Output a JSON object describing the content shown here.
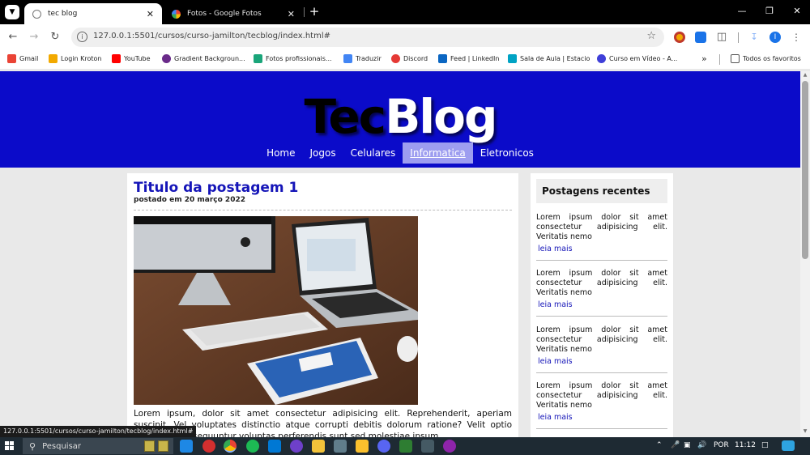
{
  "browser": {
    "tabs": [
      {
        "title": "tec blog",
        "active": true,
        "icon": "globe-icon"
      },
      {
        "title": "Fotos - Google Fotos",
        "active": false,
        "icon": "google-photos-icon"
      }
    ],
    "url": "127.0.0.1:5501/cursos/curso-jamilton/tecblog/index.html#",
    "profile_initial": "I",
    "bookmarks": [
      {
        "label": "Gmail",
        "color": "#ea4335"
      },
      {
        "label": "Login Kroton",
        "color": "#f2a900"
      },
      {
        "label": "YouTube",
        "color": "#ff0000"
      },
      {
        "label": "Gradient Backgroun...",
        "color": "#6a2b8a"
      },
      {
        "label": "Fotos profissionais...",
        "color": "#1aa57a"
      },
      {
        "label": "Traduzir",
        "color": "#4285f4"
      },
      {
        "label": "Discord",
        "color": "#e53935"
      },
      {
        "label": "Feed | LinkedIn",
        "color": "#0a66c2"
      },
      {
        "label": "Sala de Aula | Estacio",
        "color": "#00a3c4"
      },
      {
        "label": "Curso em Vídeo - A...",
        "color": "#3f3fd8"
      }
    ],
    "bookmarks_folder": "Todos os favoritos",
    "status_url": "127.0.0.1:5501/cursos/curso-jamilton/tecblog/index.html#"
  },
  "site": {
    "logo_part1": "Tec",
    "logo_part2": "Blog",
    "header_color": "#0b0bc9",
    "menu": [
      {
        "label": "Home",
        "active": false
      },
      {
        "label": "Jogos",
        "active": false
      },
      {
        "label": "Celulares",
        "active": false
      },
      {
        "label": "Informatica",
        "active": true
      },
      {
        "label": "Eletronicos",
        "active": false
      }
    ],
    "post": {
      "title": "Titulo da postagem 1",
      "date": "postado em 20 março 2022",
      "text": "Lorem ipsum, dolor sit amet consectetur adipisicing elit. Reprehenderit, aperiam suscipit. Vel voluptates distinctio atque corrupti debitis dolorum ratione? Velit optio pellendus consequuntur voluptas perferendis sunt sed molestiae ipsum."
    },
    "sidebar": {
      "title": "Postagens recentes",
      "items": [
        {
          "text": "Lorem ipsum dolor sit amet consectetur adipisicing elit. Veritatis nemo",
          "link": "leia mais"
        },
        {
          "text": "Lorem ipsum dolor sit amet consectetur adipisicing elit. Veritatis nemo",
          "link": "leia mais"
        },
        {
          "text": "Lorem ipsum dolor sit amet consectetur adipisicing elit. Veritatis nemo",
          "link": "leia mais"
        },
        {
          "text": "Lorem ipsum dolor sit amet consectetur adipisicing elit. Veritatis nemo",
          "link": "leia mais"
        }
      ]
    }
  },
  "taskbar": {
    "search_label": "Pesquisar",
    "language": "POR",
    "time": "11:12"
  }
}
